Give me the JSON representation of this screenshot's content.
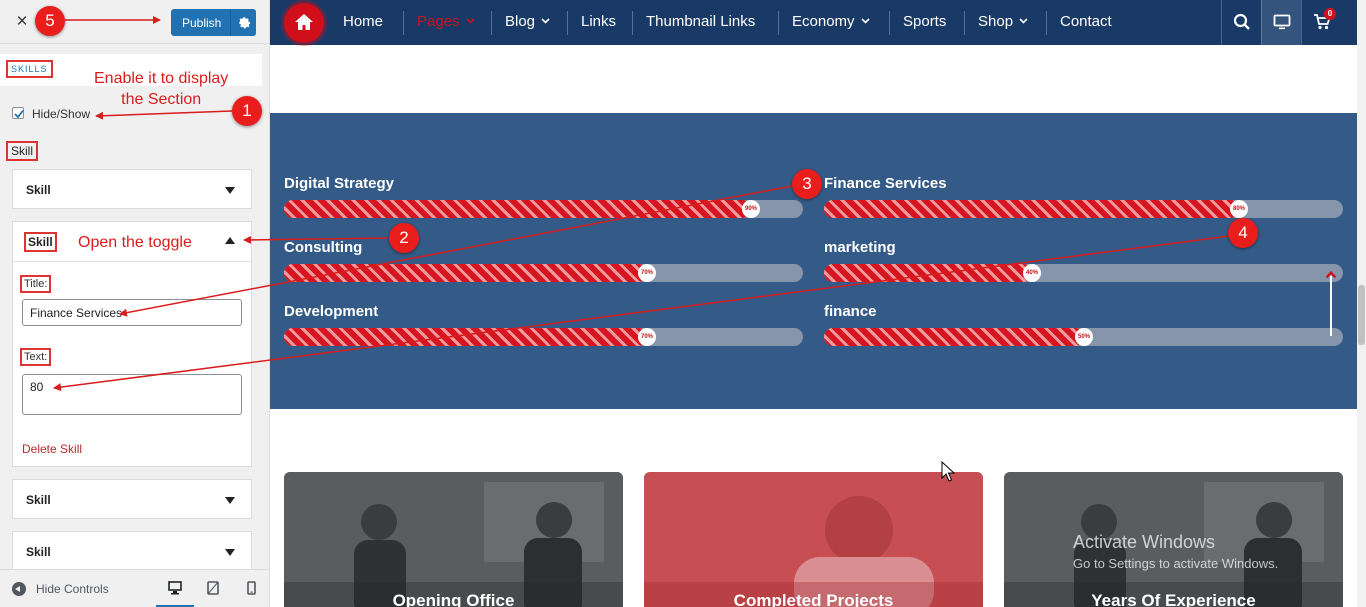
{
  "sidebar": {
    "close_icon": "×",
    "publish_label": "Publish",
    "section_title": "SKILLS",
    "hide_show_label": "Hide/Show",
    "hide_show_checked": true,
    "skill_heading": "Skill",
    "panels": [
      {
        "title": "Skill",
        "expanded": false
      },
      {
        "title": "Skill",
        "expanded": true
      },
      {
        "title": "Skill",
        "expanded": false
      },
      {
        "title": "Skill",
        "expanded": false
      }
    ],
    "editor": {
      "title_label": "Title:",
      "title_value": "Finance Services",
      "text_label": "Text:",
      "text_value": "80",
      "delete_label": "Delete Skill"
    },
    "footer": {
      "hide_controls_label": "Hide Controls",
      "devices": [
        "desktop-icon",
        "tablet-icon",
        "mobile-icon"
      ],
      "active_device": "desktop"
    }
  },
  "nav": {
    "items": [
      {
        "label": "Home",
        "dropdown": false,
        "active": false
      },
      {
        "label": "Pages",
        "dropdown": true,
        "active": true
      },
      {
        "label": "Blog",
        "dropdown": true,
        "active": false
      },
      {
        "label": "Links",
        "dropdown": false,
        "active": false
      },
      {
        "label": "Thumbnail Links",
        "dropdown": false,
        "active": false
      },
      {
        "label": "Economy",
        "dropdown": true,
        "active": false
      },
      {
        "label": "Sports",
        "dropdown": false,
        "active": false
      },
      {
        "label": "Shop",
        "dropdown": true,
        "active": false
      },
      {
        "label": "Contact",
        "dropdown": false,
        "active": false
      }
    ],
    "cart_count": "0"
  },
  "skills": [
    {
      "name": "Digital Strategy",
      "percent": 90,
      "label": "90%"
    },
    {
      "name": "Finance Services",
      "percent": 80,
      "label": "80%"
    },
    {
      "name": "Consulting",
      "percent": 70,
      "label": "70%"
    },
    {
      "name": "marketing",
      "percent": 40,
      "label": "40%"
    },
    {
      "name": "Development",
      "percent": 70,
      "label": "70%"
    },
    {
      "name": "finance",
      "percent": 50,
      "label": "50%"
    }
  ],
  "cards": [
    {
      "title": "Opening Office"
    },
    {
      "title": "Completed Projects"
    },
    {
      "title": "Years Of Experience"
    }
  ],
  "watermark": {
    "title": "Activate Windows",
    "subtitle": "Go to Settings to activate Windows."
  },
  "annotations": [
    {
      "number": "1",
      "text": "Enable it to display\nthe Section"
    },
    {
      "number": "2",
      "text": "Open the toggle"
    },
    {
      "number": "3",
      "text": ""
    },
    {
      "number": "4",
      "text": ""
    },
    {
      "number": "5",
      "text": ""
    }
  ],
  "colors": {
    "nav_bg": "#193a66",
    "accent_red": "#d10f1a",
    "skills_bg": "#345b87",
    "publish_blue": "#2271b1",
    "annotation_red": "#ea1d1d"
  }
}
